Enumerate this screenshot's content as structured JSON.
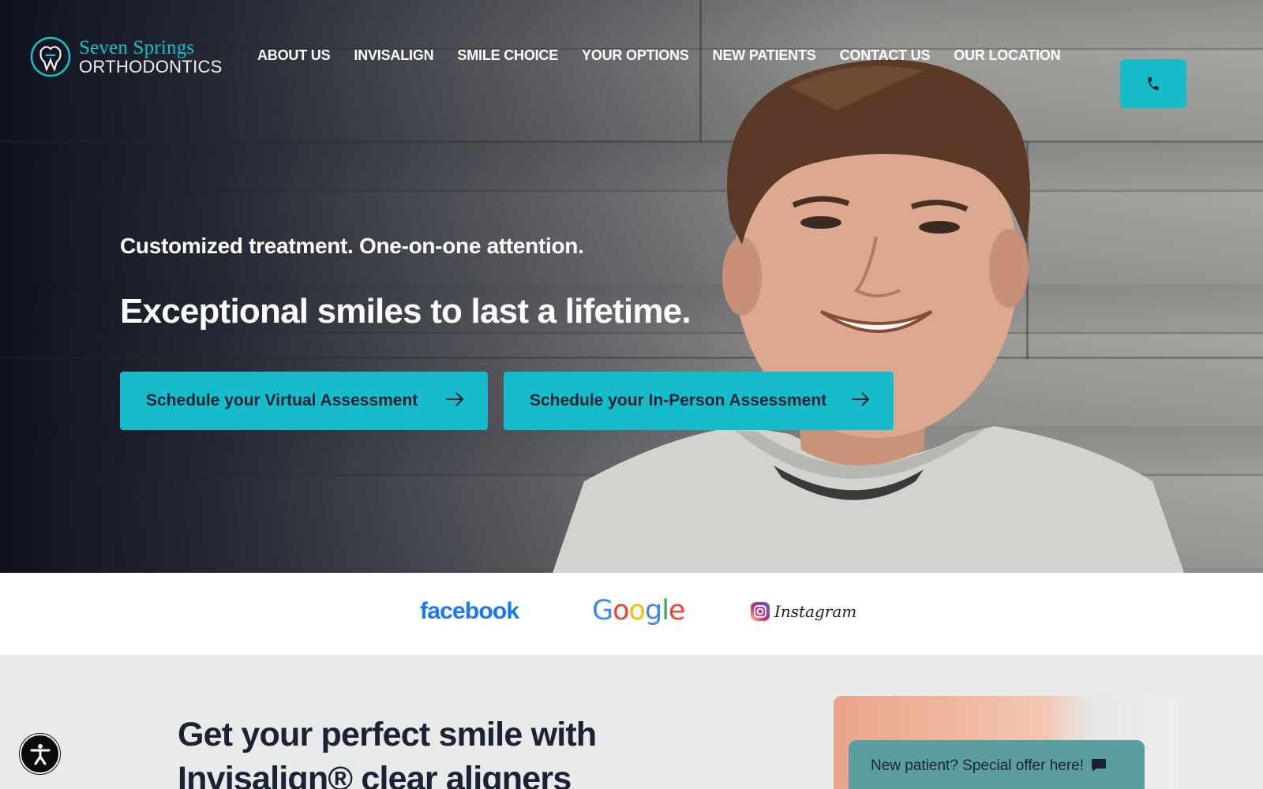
{
  "header": {
    "logo_line1": "Seven Springs",
    "logo_line2": "ORTHODONTICS",
    "nav": [
      "ABOUT US",
      "INVISALIGN",
      "SMILE CHOICE",
      "YOUR OPTIONS",
      "NEW PATIENTS",
      "CONTACT US",
      "OUR LOCATION"
    ],
    "phone_icon": "phone-icon"
  },
  "hero": {
    "tagline": "Customized treatment. One-on-one attention.",
    "headline": "Exceptional smiles to last a lifetime.",
    "cta_virtual": "Schedule your Virtual Assessment",
    "cta_in_person": "Schedule your In-Person Assessment"
  },
  "social": {
    "facebook": "facebook",
    "google": "Google",
    "instagram": "Instagram"
  },
  "section": {
    "title": "Get your perfect smile with Invisalign® clear aligners",
    "offer": "New patient? Special offer here!"
  },
  "colors": {
    "accent": "#16bcc9",
    "dark": "#1b2233",
    "offer_bg": "#5b9ea0"
  }
}
